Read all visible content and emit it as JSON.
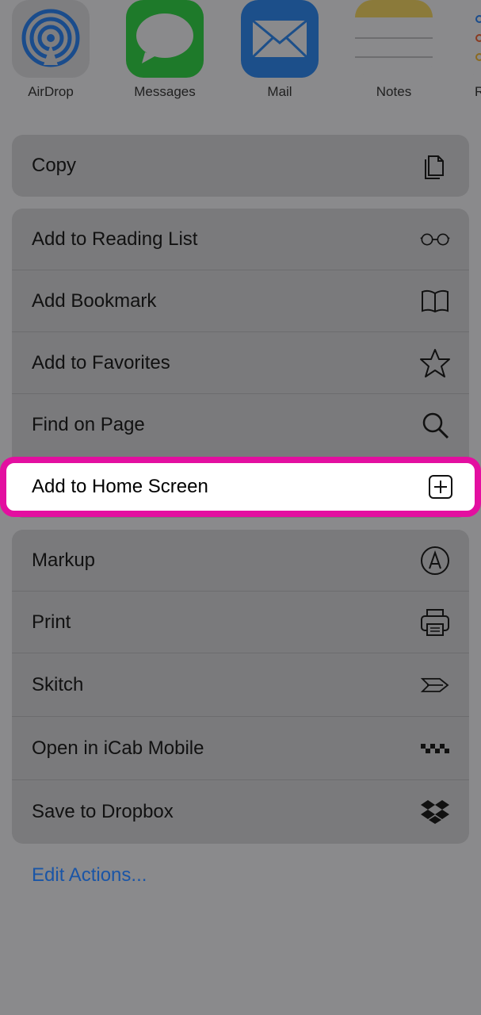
{
  "apps": [
    {
      "label": "AirDrop",
      "icon": "airdrop-icon"
    },
    {
      "label": "Messages",
      "icon": "messages-icon"
    },
    {
      "label": "Mail",
      "icon": "mail-icon"
    },
    {
      "label": "Notes",
      "icon": "notes-icon"
    },
    {
      "label": "R",
      "icon": "reminders-icon"
    }
  ],
  "copy_group": [
    {
      "label": "Copy",
      "icon": "copy-icon"
    }
  ],
  "actions_group": [
    {
      "label": "Add to Reading List",
      "icon": "glasses-icon"
    },
    {
      "label": "Add Bookmark",
      "icon": "book-icon"
    },
    {
      "label": "Add to Favorites",
      "icon": "star-icon"
    },
    {
      "label": "Find on Page",
      "icon": "search-icon"
    }
  ],
  "highlighted": {
    "label": "Add to Home Screen",
    "icon": "plus-square-icon",
    "highlight_color": "#e30fa0"
  },
  "extensions_group": [
    {
      "label": "Markup",
      "icon": "markup-icon"
    },
    {
      "label": "Print",
      "icon": "printer-icon"
    },
    {
      "label": "Skitch",
      "icon": "skitch-icon"
    },
    {
      "label": "Open in iCab Mobile",
      "icon": "icab-icon"
    },
    {
      "label": "Save to Dropbox",
      "icon": "dropbox-icon"
    }
  ],
  "edit_actions": {
    "label": "Edit Actions..."
  },
  "colors": {
    "dim_background": "#8a8a8c",
    "link": "#1a55a6"
  }
}
